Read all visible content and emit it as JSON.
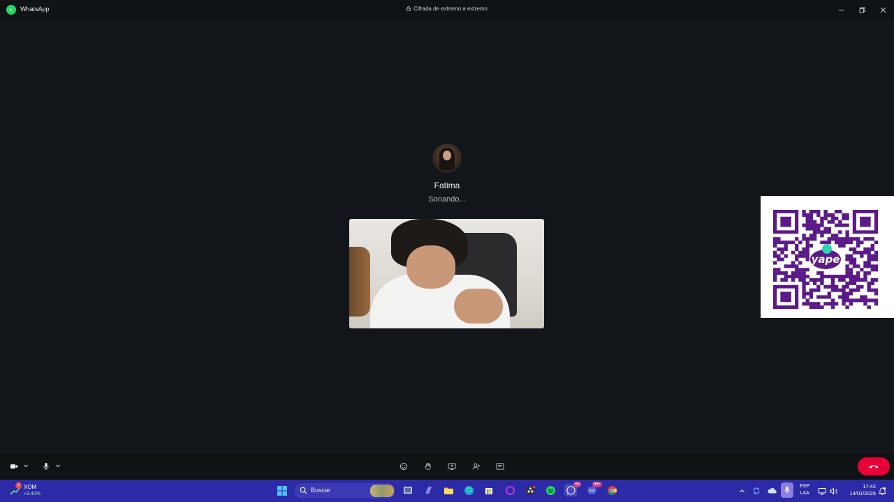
{
  "window": {
    "app_title": "WhatsApp",
    "encryption_text": "Cifrada de extremo a extremo",
    "controls": {
      "minimize": "—",
      "maximize": "❐",
      "close": "✕"
    }
  },
  "call": {
    "callee_name": "Fatima",
    "status": "Sonando...",
    "qr_brand": "yape",
    "end_call_color": "#ea0038"
  },
  "controls_bar": {
    "left": [
      "video-camera-icon",
      "chevron-down-icon",
      "microphone-icon",
      "chevron-down-icon"
    ],
    "center": [
      "emoji-reaction-icon",
      "raise-hand-icon",
      "screen-share-icon",
      "add-participant-icon",
      "call-chat-icon"
    ],
    "right": [
      "end-call-icon"
    ]
  },
  "taskbar": {
    "stock_ticker": "XOM",
    "stock_change": "+3.40%",
    "stock_badge": "2",
    "search_label": "Buscar",
    "whatsapp_badge": "50",
    "discord_badge": "99+",
    "language_line1": "ESP",
    "language_line2": "LAA",
    "time": "17:42",
    "date": "14/01/2026",
    "accent": "#2d2aa8"
  }
}
